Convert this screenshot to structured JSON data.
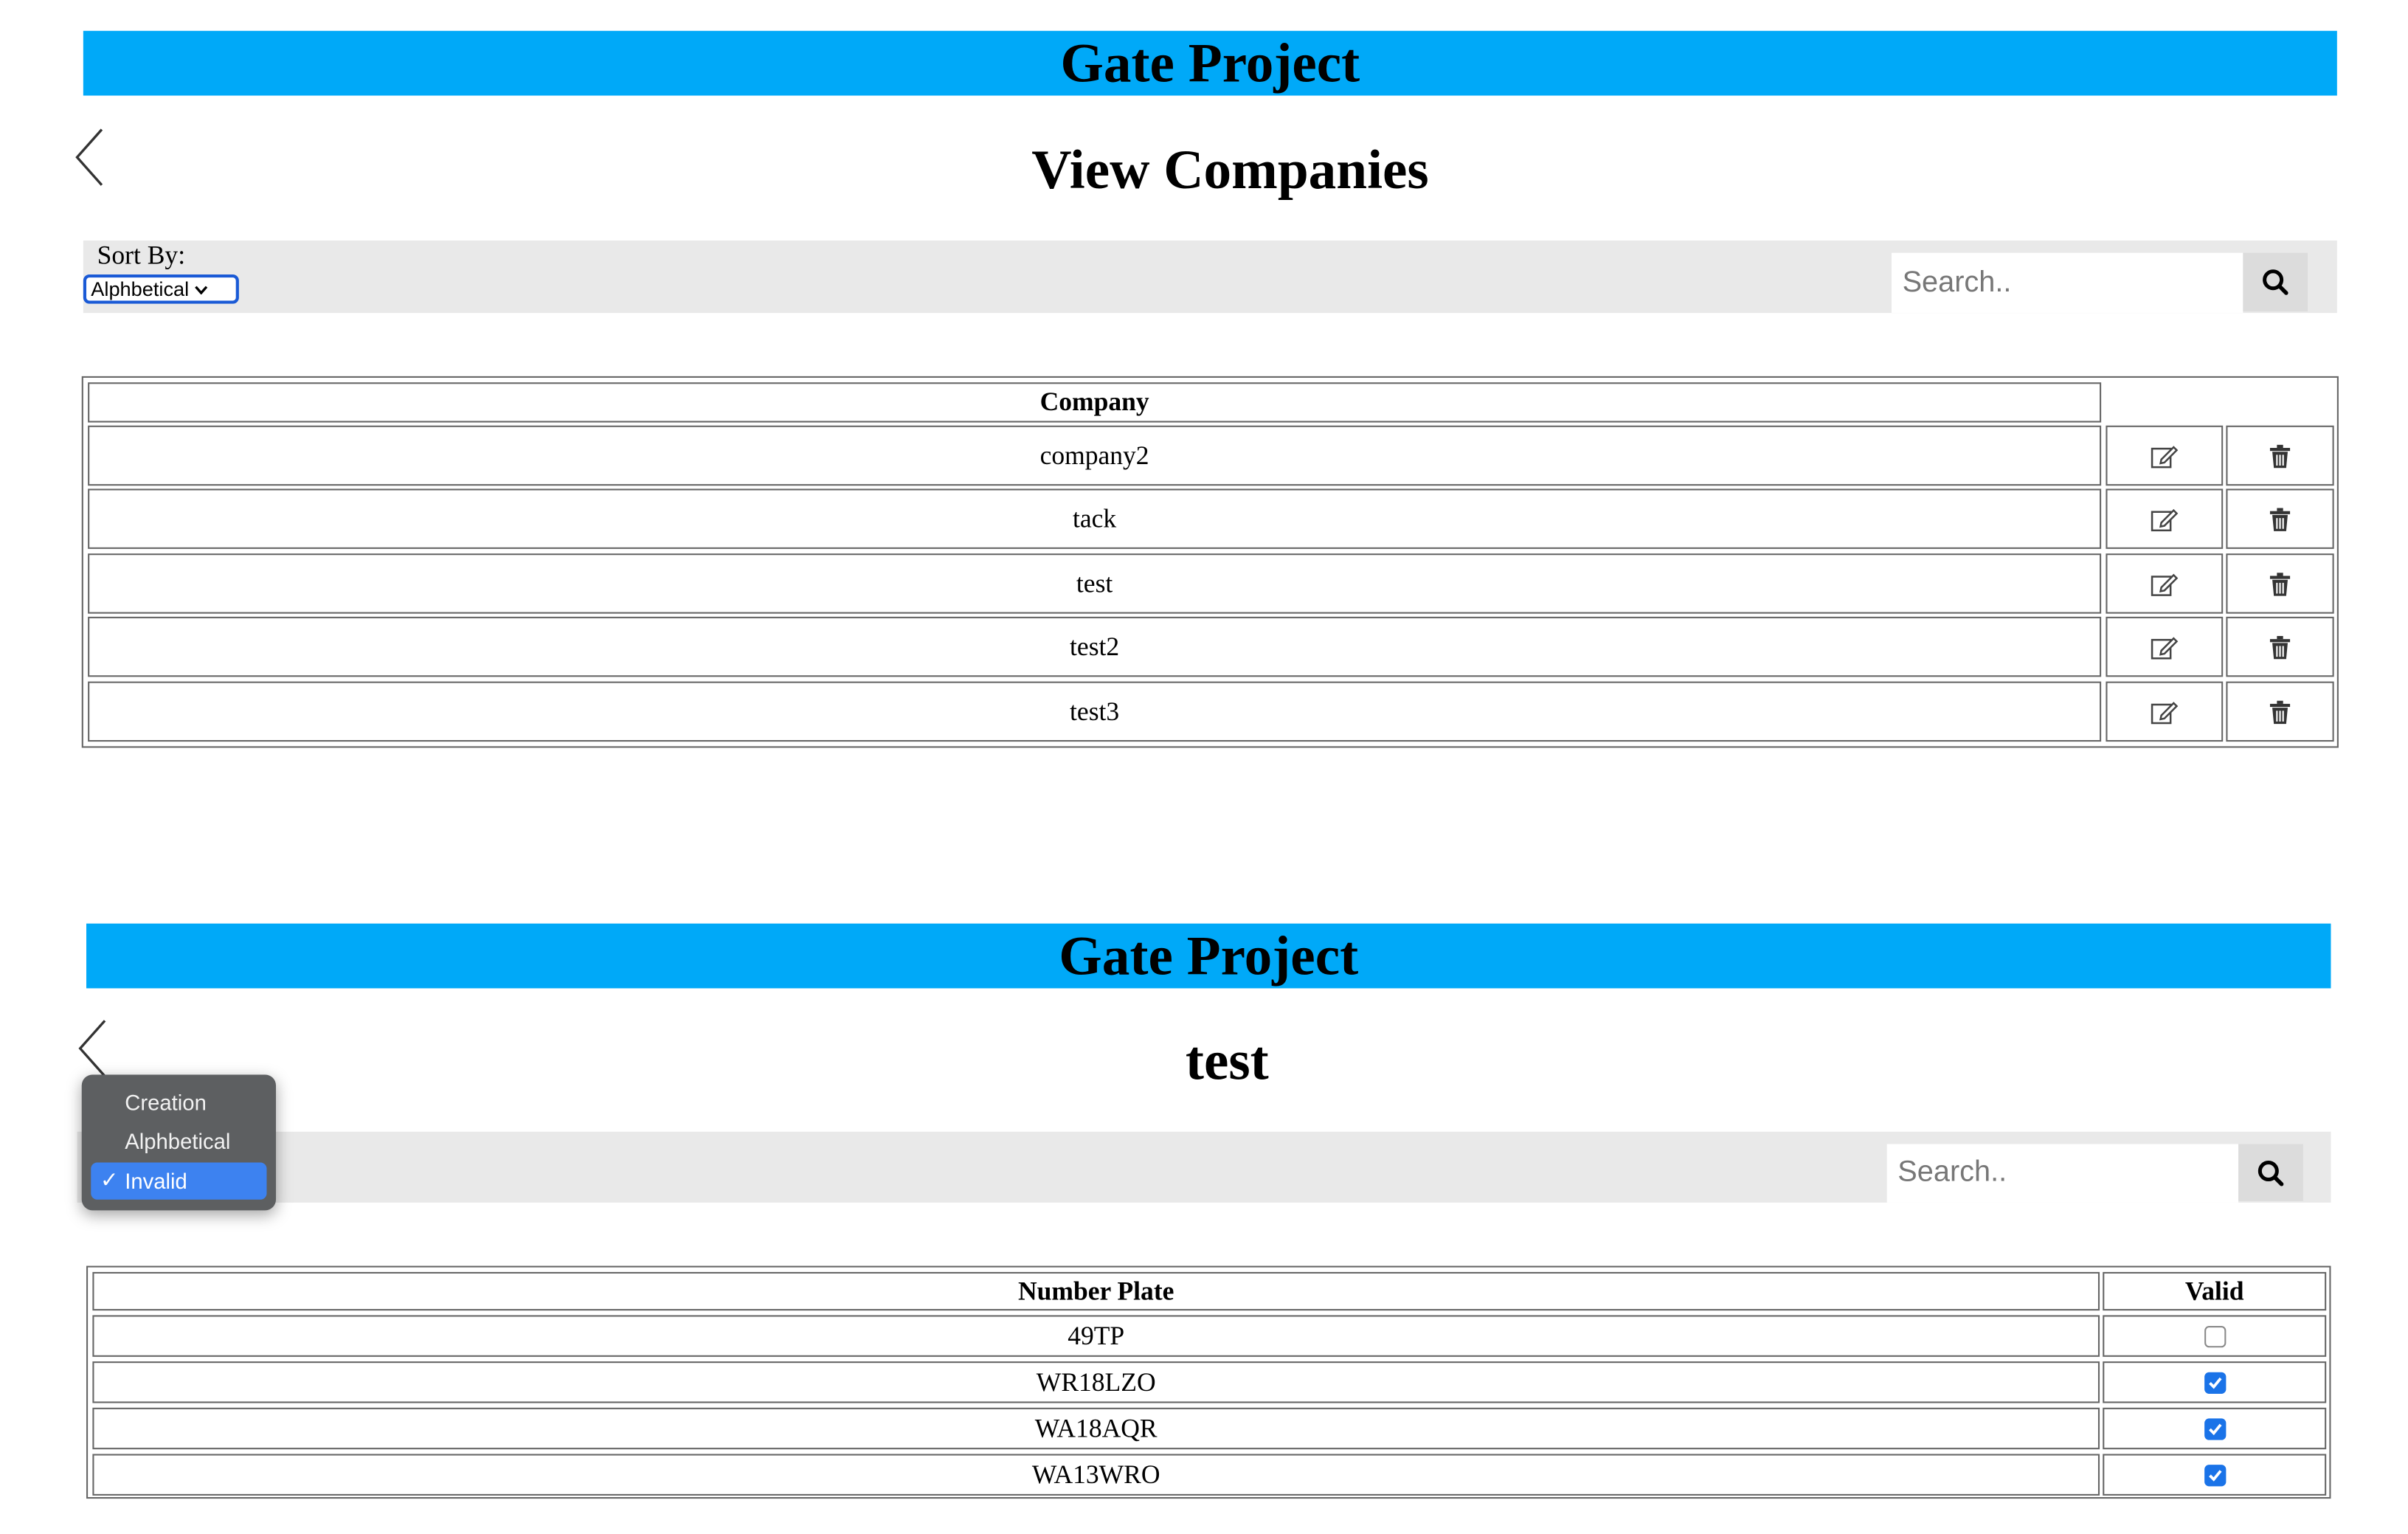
{
  "colors": {
    "banner": "#00a9f8",
    "toolbar": "#e9e9e9",
    "checkbox_checked": "#1a73e8",
    "dropdown_bg": "#5d5f61",
    "dropdown_selected": "#3d82f0"
  },
  "panel1": {
    "header": "Gate Project",
    "back_icon": "chevron-left-icon",
    "title": "View Companies",
    "sort_label": "Sort By:",
    "sort_value": "Alphbetical",
    "search_placeholder": "Search..",
    "search_icon": "search-icon",
    "table": {
      "column": "Company",
      "edit_icon": "edit-icon",
      "delete_icon": "trash-icon",
      "rows": [
        "company2",
        "tack",
        "test",
        "test2",
        "test3"
      ]
    }
  },
  "panel2": {
    "header": "Gate Project",
    "back_icon": "chevron-left-icon",
    "title": "test",
    "search_placeholder": "Search..",
    "search_icon": "search-icon",
    "sort_dropdown": {
      "options": [
        "Creation",
        "Alphbetical",
        "Invalid"
      ],
      "selected": "Invalid"
    },
    "table": {
      "columns": [
        "Number Plate",
        "Valid"
      ],
      "rows": [
        {
          "plate": "49TP",
          "valid": false
        },
        {
          "plate": "WR18LZO",
          "valid": true
        },
        {
          "plate": "WA18AQR",
          "valid": true
        },
        {
          "plate": "WA13WRO",
          "valid": true
        }
      ]
    }
  }
}
